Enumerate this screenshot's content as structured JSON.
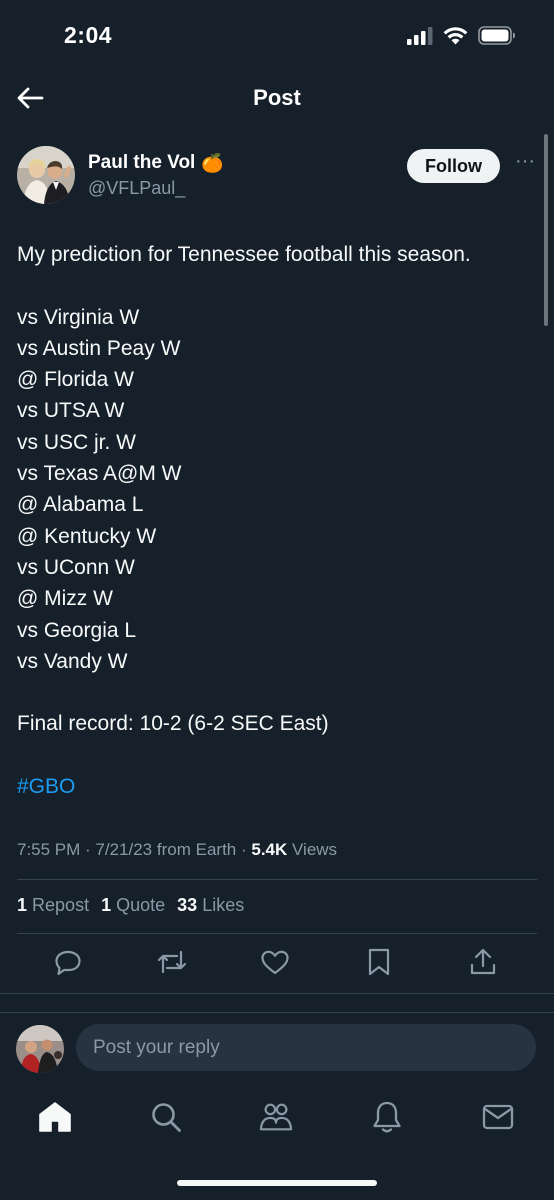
{
  "status_bar": {
    "time": "2:04"
  },
  "header": {
    "title": "Post"
  },
  "author": {
    "name": "Paul the Vol",
    "emoji": "🍊",
    "handle": "@VFLPaul_"
  },
  "follow_label": "Follow",
  "more_label": "···",
  "tweet": {
    "lines": [
      "My prediction for Tennessee football this season.",
      "",
      "vs Virginia W",
      "vs Austin Peay W",
      "@ Florida W",
      "vs UTSA W",
      "vs USC jr. W",
      "vs Texas A@M W",
      "@ Alabama L",
      "@ Kentucky W",
      "vs UConn W",
      "@ Mizz W",
      "vs Georgia L",
      "vs Vandy W",
      "",
      "Final record: 10-2 (6-2 SEC East)",
      ""
    ],
    "hashtag": "#GBO"
  },
  "meta": {
    "time": "7:55 PM",
    "date": "7/21/23",
    "source": "from Earth",
    "views_count": "5.4K",
    "views_label": "Views"
  },
  "stats": {
    "reposts_count": "1",
    "reposts_label": "Repost",
    "quotes_count": "1",
    "quotes_label": "Quote",
    "likes_count": "33",
    "likes_label": "Likes"
  },
  "reply": {
    "placeholder": "Post your reply"
  },
  "colors": {
    "background": "#15202b",
    "accent": "#1d9bf0",
    "muted": "#8b98a5",
    "divider": "#38444d"
  },
  "icons": {
    "status": [
      "signal-icon",
      "wifi-icon",
      "battery-icon"
    ],
    "actions": [
      "reply-icon",
      "repost-icon",
      "like-icon",
      "bookmark-icon",
      "share-icon"
    ],
    "tabs": [
      "home-icon",
      "search-icon",
      "communities-icon",
      "notifications-icon",
      "messages-icon"
    ]
  }
}
